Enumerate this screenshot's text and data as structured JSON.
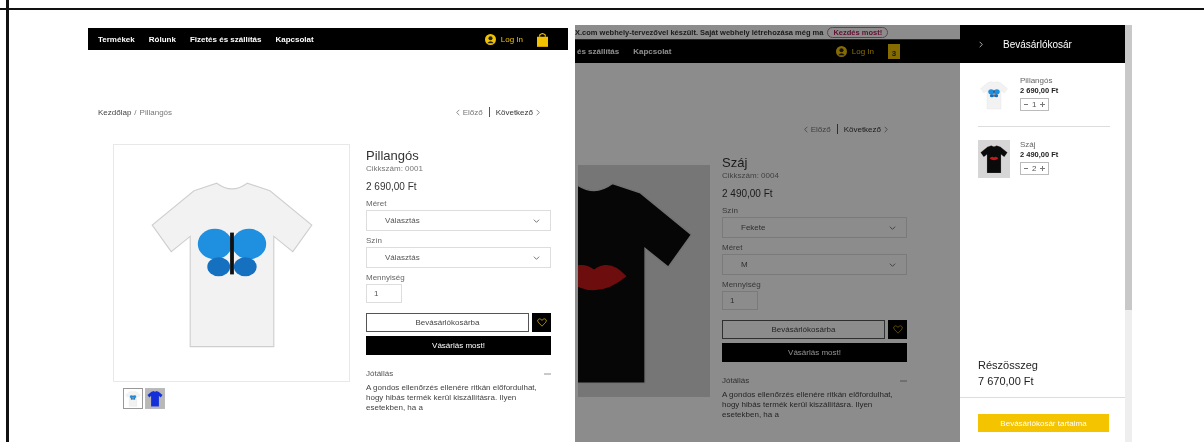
{
  "left_screen": {
    "nav": {
      "items": [
        "Termékek",
        "Rólunk",
        "Fizetés és szállítás",
        "Kapcsolat"
      ],
      "login": "Log In"
    },
    "breadcrumb": {
      "home": "Kezdőlap",
      "separator": "/",
      "current": "Pillangós"
    },
    "pager": {
      "prev": "Előző",
      "next": "Következő"
    },
    "product": {
      "kind": "butterfly",
      "title": "Pillangós",
      "sku": "Cikkszám: 0001",
      "price": "2 690,00 Ft",
      "options": [
        {
          "label": "Méret",
          "value": "Választás"
        },
        {
          "label": "Szín",
          "value": "Választás"
        }
      ],
      "quantity_label": "Mennyiség",
      "quantity": "1",
      "add_to_cart": "Bevásárlókosárba",
      "buy_now": "Vásárlás most!",
      "info_title": "Jótállás",
      "info_text": "A gondos ellenőrzés ellenére ritkán előfordulhat, hogy hibás termék kerül kiszállításra. Ilyen esetekben, ha a",
      "thumbnails": [
        {
          "kind": "butterfly",
          "selected": true
        },
        {
          "kind": "blue",
          "selected": false
        }
      ]
    }
  },
  "right_screen": {
    "banner": {
      "text": "X.com webhely-tervezővel készült. Saját webhely létrehozása még ma",
      "button": "Kezdés most!"
    },
    "nav": {
      "items": [
        "és szállítás",
        "Kapcsolat"
      ],
      "login": "Log In",
      "cart_count": "3"
    },
    "dimmed": true,
    "pager": {
      "prev": "Előző",
      "next": "Következő"
    },
    "product": {
      "kind": "lips",
      "title": "Száj",
      "sku": "Cikkszám: 0004",
      "price": "2 490,00 Ft",
      "options": [
        {
          "label": "Szín",
          "value": "Fekete"
        },
        {
          "label": "Méret",
          "value": "M"
        }
      ],
      "quantity_label": "Mennyiség",
      "quantity": "1",
      "add_to_cart": "Bevásárlókosárba",
      "buy_now": "Vásárlás most!",
      "info_title": "Jótállás",
      "info_text": "A gondos ellenőrzés ellenére ritkán előfordulhat, hogy hibás termék kerül kiszállításra. Ilyen esetekben, ha a"
    },
    "cart": {
      "title": "Bevásárlókosár",
      "items": [
        {
          "kind": "butterfly",
          "name": "Pillangós",
          "price": "2 690,00 Ft",
          "quantity": "1"
        },
        {
          "kind": "lips",
          "name": "Száj",
          "price": "2 490,00 Ft",
          "quantity": "2"
        }
      ],
      "subtotal_label": "Részösszeg",
      "subtotal": "7 670,00 Ft",
      "checkout": "Bevásárlókosár tartalma"
    }
  }
}
